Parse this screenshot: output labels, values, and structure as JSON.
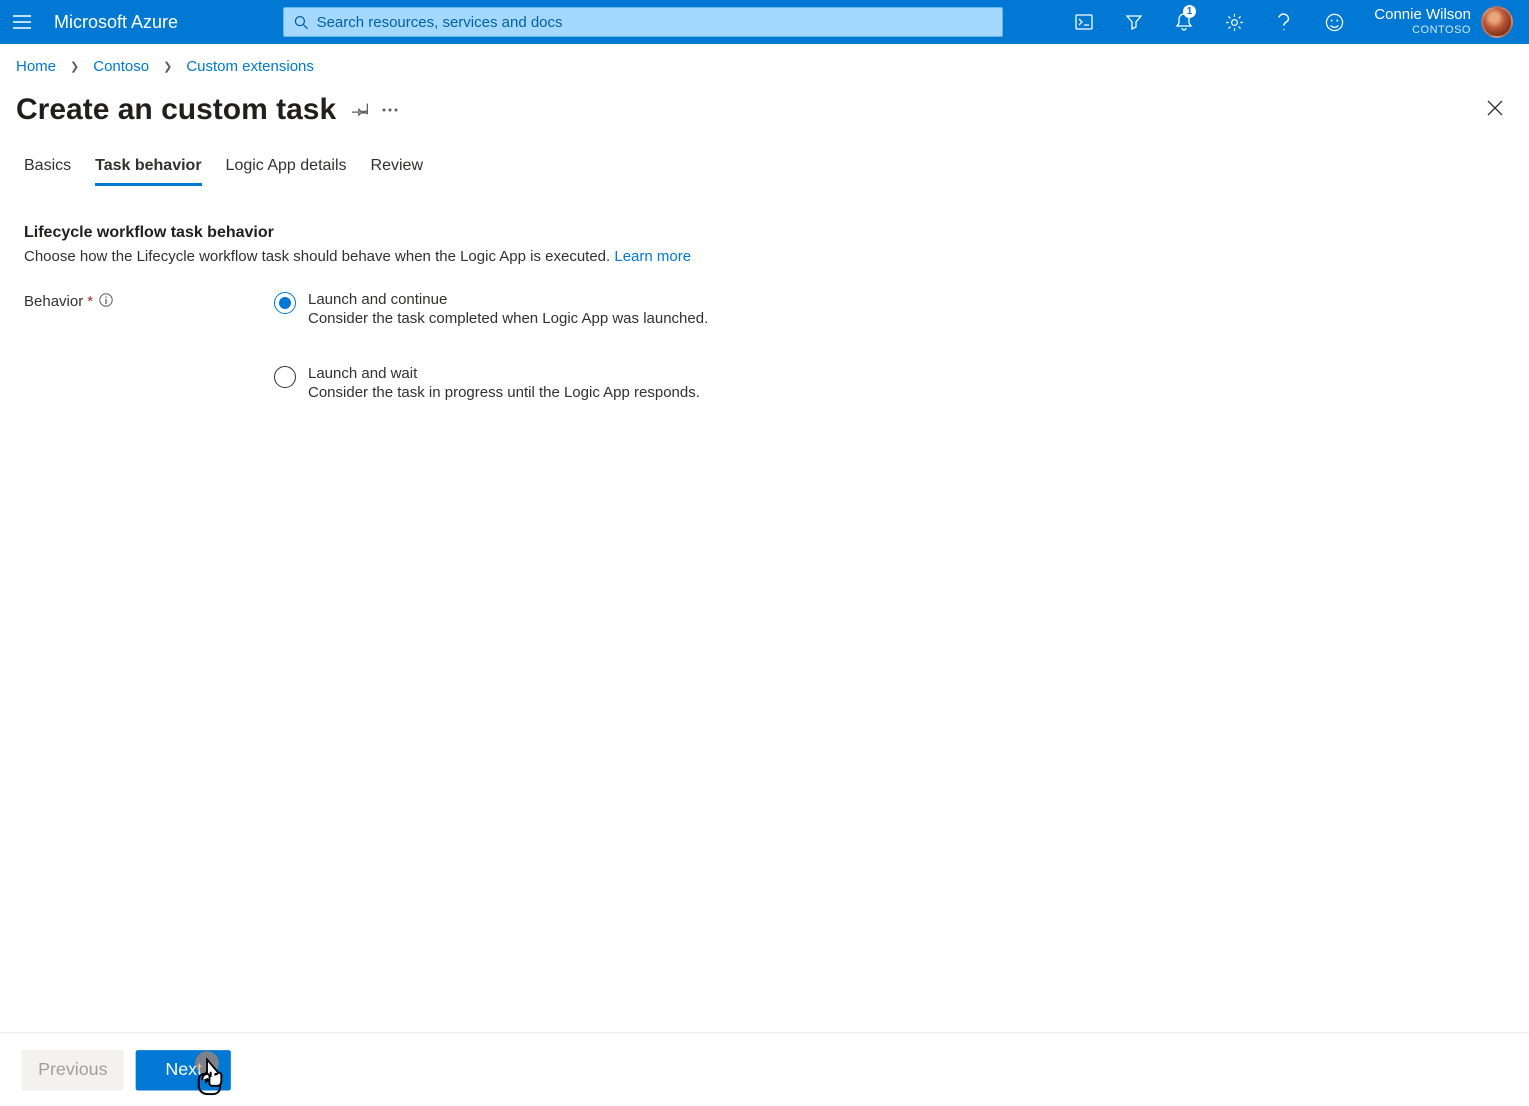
{
  "header": {
    "brand": "Microsoft Azure",
    "search_placeholder": "Search resources, services and docs",
    "notification_count": "1",
    "user_name": "Connie Wilson",
    "tenant": "CONTOSO"
  },
  "breadcrumb": {
    "items": [
      "Home",
      "Contoso",
      "Custom extensions"
    ]
  },
  "page": {
    "title": "Create an custom task"
  },
  "tabs": [
    {
      "label": "Basics",
      "active": false
    },
    {
      "label": "Task behavior",
      "active": true
    },
    {
      "label": "Logic App details",
      "active": false
    },
    {
      "label": "Review",
      "active": false
    }
  ],
  "section": {
    "title": "Lifecycle workflow task behavior",
    "description": "Choose how the Lifecycle workflow task should behave when the Logic App is executed. ",
    "learn_more": "Learn more"
  },
  "field": {
    "label": "Behavior"
  },
  "radio_options": [
    {
      "label": "Launch and continue",
      "desc": "Consider the task completed when Logic App was launched.",
      "selected": true
    },
    {
      "label": "Launch and wait",
      "desc": "Consider the task in progress until the Logic App responds.",
      "selected": false
    }
  ],
  "footer": {
    "previous": "Previous",
    "next": "Next"
  }
}
